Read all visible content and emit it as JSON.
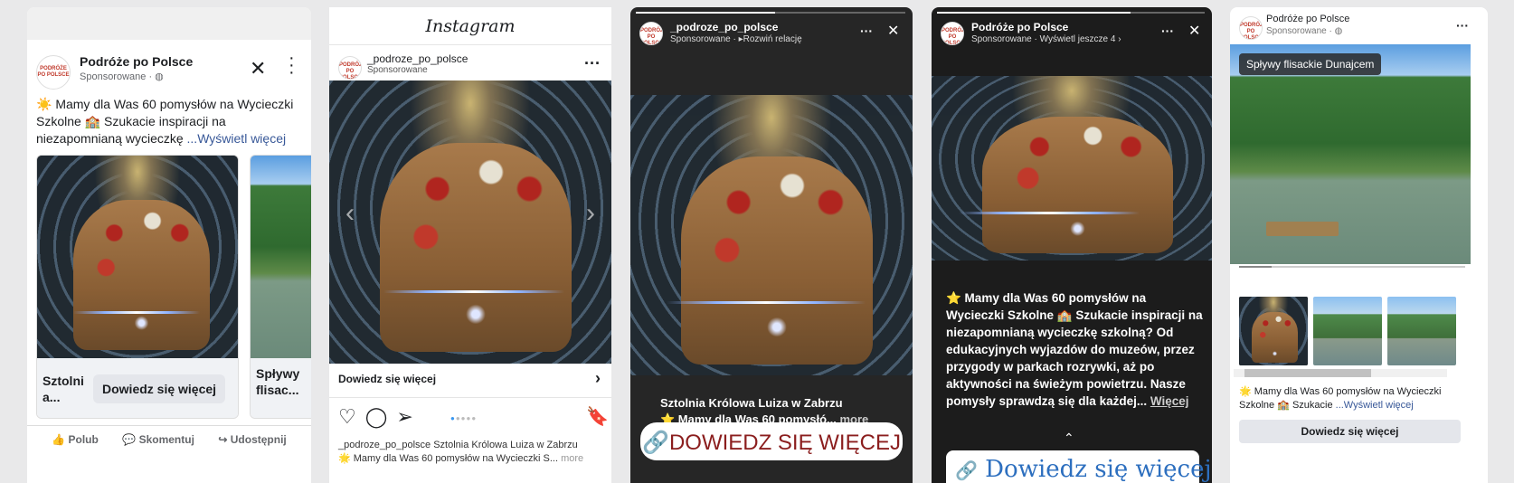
{
  "logo_text": "PODRÓŻE PO POLSCE",
  "fb": {
    "page": "Podróże po Polsce",
    "sponsored": "Sponsorowane · ",
    "text_a": "☀️ Mamy dla Was 60 pomysłów na Wycieczki Szkolne 🏫 Szukacie inspiracji na niezapomnianą wycieczkę",
    "more": "...Wyświetl więcej",
    "card1_title": "Sztolni a...",
    "card1_btn": "Dowiedz się więcej",
    "card2_title": "Spływy flisac...",
    "like": "Polub",
    "comment": "Skomentuj",
    "share": "Udostępnij"
  },
  "ig": {
    "app_title": "Instagram",
    "account": "_podroze_po_polsce",
    "sponsored": "Sponsorowane",
    "cta": "Dowiedz się więcej",
    "caption_line1": "_podroze_po_polsce Sztolnia Królowa Luiza w Zabrzu",
    "caption_line2": "🌟 Mamy dla Was 60 pomysłów na Wycieczki S...",
    "more": "more"
  },
  "igs": {
    "account": "_podroze_po_polsce",
    "sub": "Sponsorowane · ▸Rozwiń relację",
    "title": "Sztolnia Królowa Luiza w Zabrzu",
    "text": "⭐ Mamy dla Was 60 pomysłó...",
    "more": "more",
    "cta": "DOWIEDZ SIĘ WIĘCEJ"
  },
  "fbs": {
    "account": "Podróże po Polsce",
    "sub": "Sponsorowane · Wyświetl jeszcze 4",
    "text": "⭐ Mamy dla Was 60 pomysłów na Wycieczki Szkolne 🏫 Szukacie inspiracji na niezapomnianą wycieczkę szkolną? Od edukacyjnych wyjazdów do muzeów, przez przygody w parkach rozrywki, aż po aktywności na świeżym powietrzu. Nasze pomysły sprawdzą się dla każdej...",
    "more": "Więcej",
    "cta": "Dowiedz się więcej"
  },
  "mp": {
    "page": "Podróże po Polsce",
    "sponsored": "Sponsorowane · ",
    "badge": "Spływy flisackie Dunajcem",
    "text": "🌟 Mamy dla Was 60 pomysłów na Wycieczki Szkolne 🏫 Szukacie",
    "more": "...Wyświetl więcej",
    "cta": "Dowiedz się więcej"
  }
}
